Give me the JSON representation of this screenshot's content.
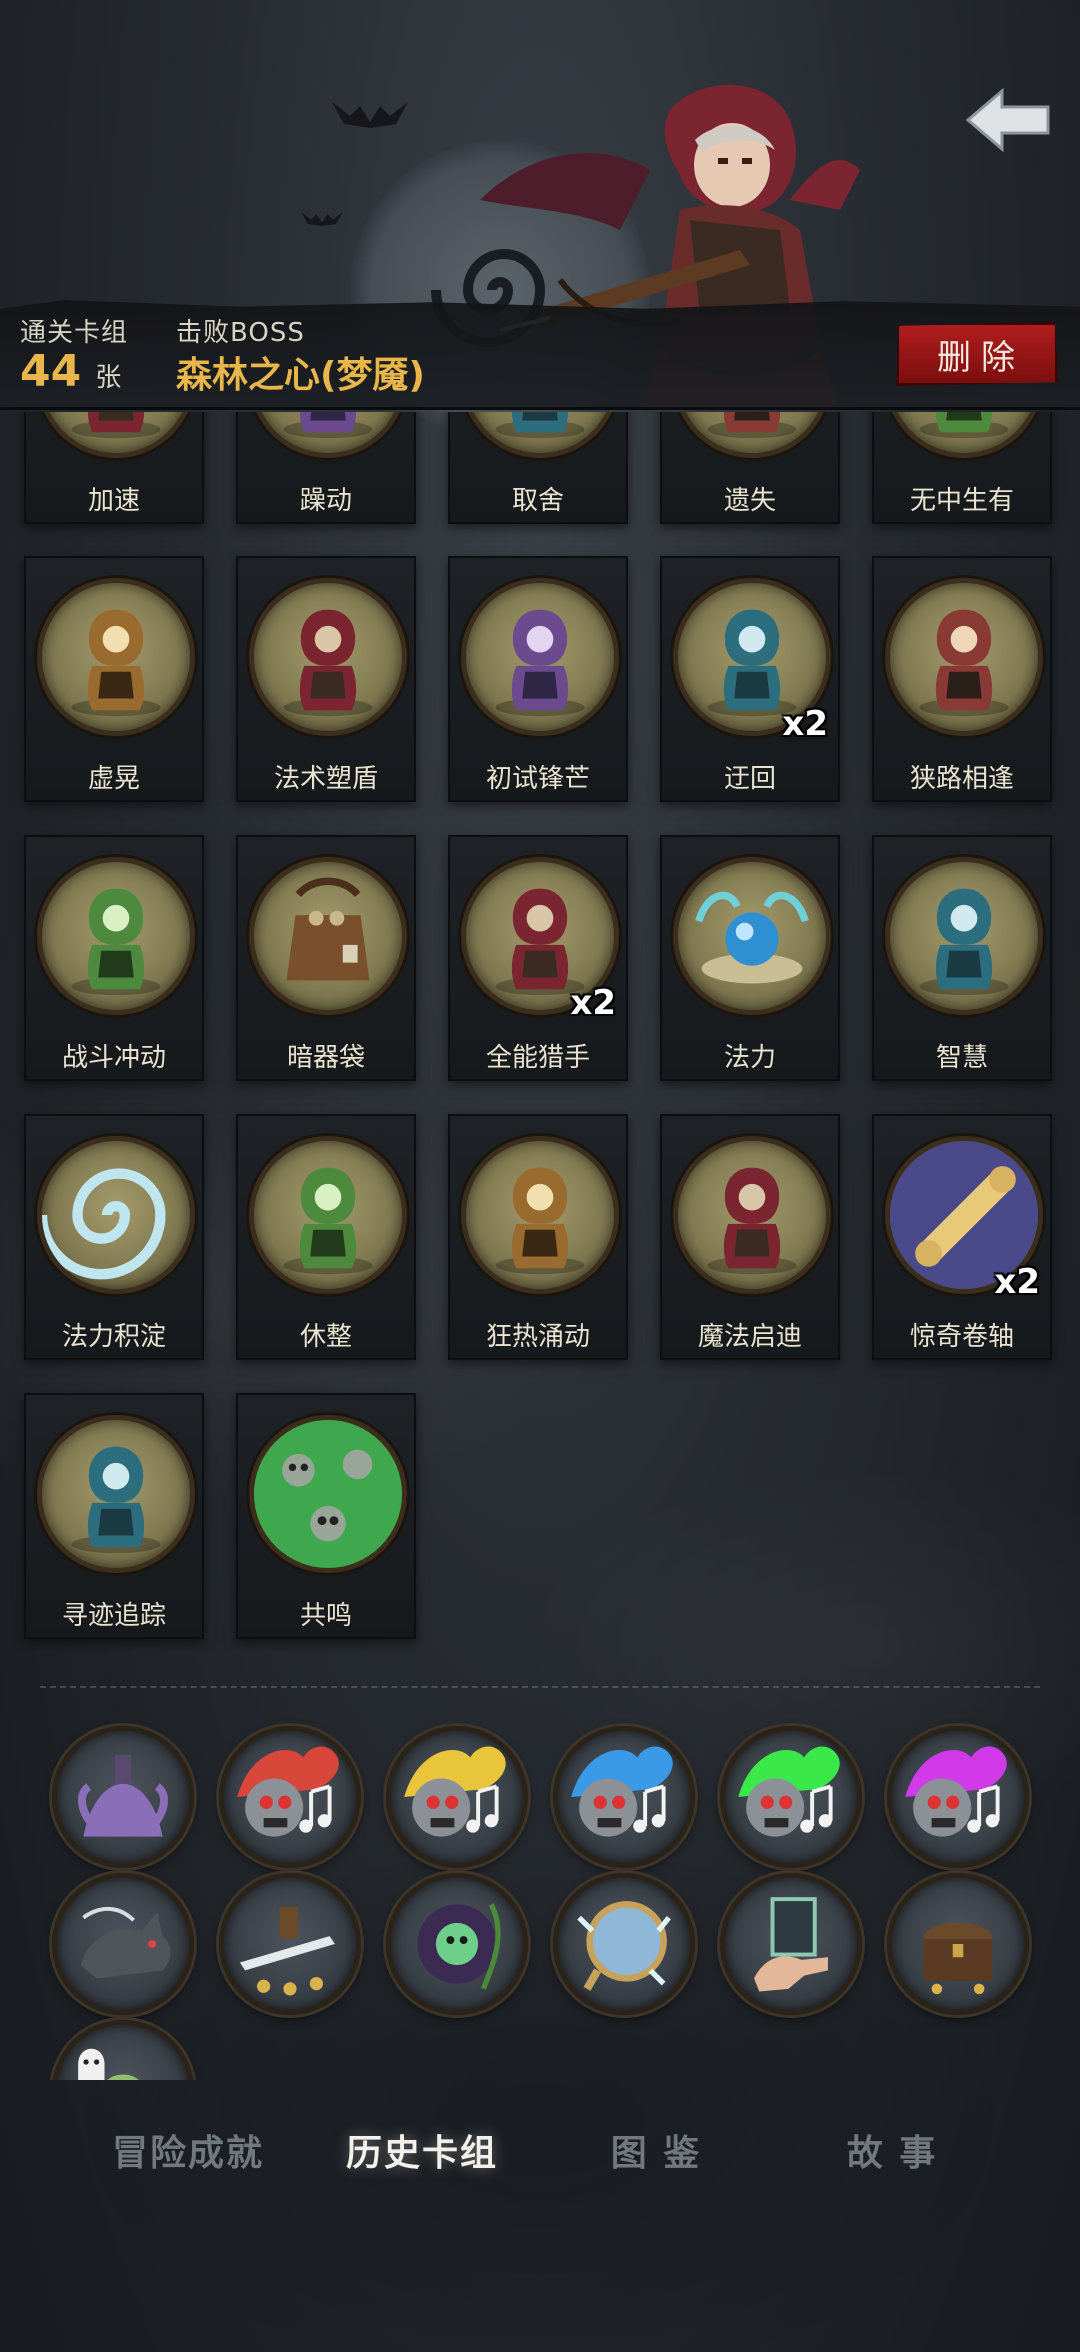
{
  "header": {
    "clear_deck_label": "通关卡组",
    "card_count": "44",
    "card_unit": "张",
    "defeat_boss_label": "击败BOSS",
    "boss_name": "森林之心(梦魇)",
    "delete_label": "删除"
  },
  "cards": [
    {
      "name": "加速",
      "icon": "speed-hero-art",
      "badge": ""
    },
    {
      "name": "躁动",
      "icon": "restless-art",
      "badge": ""
    },
    {
      "name": "取舍",
      "icon": "tradeoff-art",
      "badge": ""
    },
    {
      "name": "遗失",
      "icon": "lost-art",
      "badge": ""
    },
    {
      "name": "无中生有",
      "icon": "something-from-nothing-art",
      "badge": ""
    },
    {
      "name": "虚晃",
      "icon": "boxer-feint-art",
      "badge": ""
    },
    {
      "name": "法术塑盾",
      "icon": "spell-shield-art",
      "badge": ""
    },
    {
      "name": "初试锋芒",
      "icon": "first-blood-art",
      "badge": ""
    },
    {
      "name": "迂回",
      "icon": "flank-art",
      "badge": "x2"
    },
    {
      "name": "狭路相逢",
      "icon": "narrow-path-art",
      "badge": ""
    },
    {
      "name": "战斗冲动",
      "icon": "battle-urge-art",
      "badge": ""
    },
    {
      "name": "暗器袋",
      "icon": "hidden-weapon-pouch-art",
      "badge": ""
    },
    {
      "name": "全能猎手",
      "icon": "all-round-hunter-art",
      "badge": "x2"
    },
    {
      "name": "法力",
      "icon": "mana-orb-art",
      "badge": ""
    },
    {
      "name": "智慧",
      "icon": "wisdom-sage-art",
      "badge": ""
    },
    {
      "name": "法力积淀",
      "icon": "mana-vortex-art",
      "badge": ""
    },
    {
      "name": "休整",
      "icon": "rest-art",
      "badge": ""
    },
    {
      "name": "狂热涌动",
      "icon": "fervor-surge-art",
      "badge": ""
    },
    {
      "name": "魔法启迪",
      "icon": "magic-enlightenment-art",
      "badge": ""
    },
    {
      "name": "惊奇卷轴",
      "icon": "scroll-art",
      "badge": "x2"
    },
    {
      "name": "寻迹追踪",
      "icon": "tracking-art",
      "badge": ""
    },
    {
      "name": "共鸣",
      "icon": "resonance-skulls-art",
      "badge": ""
    }
  ],
  "relics": [
    {
      "icon": "tentacle-altar-icon"
    },
    {
      "icon": "music-skull-red-icon"
    },
    {
      "icon": "music-skull-yellow-icon"
    },
    {
      "icon": "music-skull-blue-icon"
    },
    {
      "icon": "music-skull-green-icon"
    },
    {
      "icon": "music-skull-purple-icon"
    },
    {
      "icon": "wolf-icon"
    },
    {
      "icon": "sword-coins-icon"
    },
    {
      "icon": "green-skull-aura-icon"
    },
    {
      "icon": "frost-mirror-icon"
    },
    {
      "icon": "card-hand-icon"
    },
    {
      "icon": "treasure-chest-icon"
    },
    {
      "icon": "ghost-slime-icon"
    }
  ],
  "tabs": [
    {
      "label": "冒险成就",
      "active": false
    },
    {
      "label": "历史卡组",
      "active": true
    },
    {
      "label": "图 鉴",
      "active": false
    },
    {
      "label": "故 事",
      "active": false
    }
  ],
  "colors": {
    "accent_gold": "#e8b64a",
    "delete_red": "#a51818",
    "card_bg": "#1b1f23",
    "disc_fill": "#8e865c"
  }
}
